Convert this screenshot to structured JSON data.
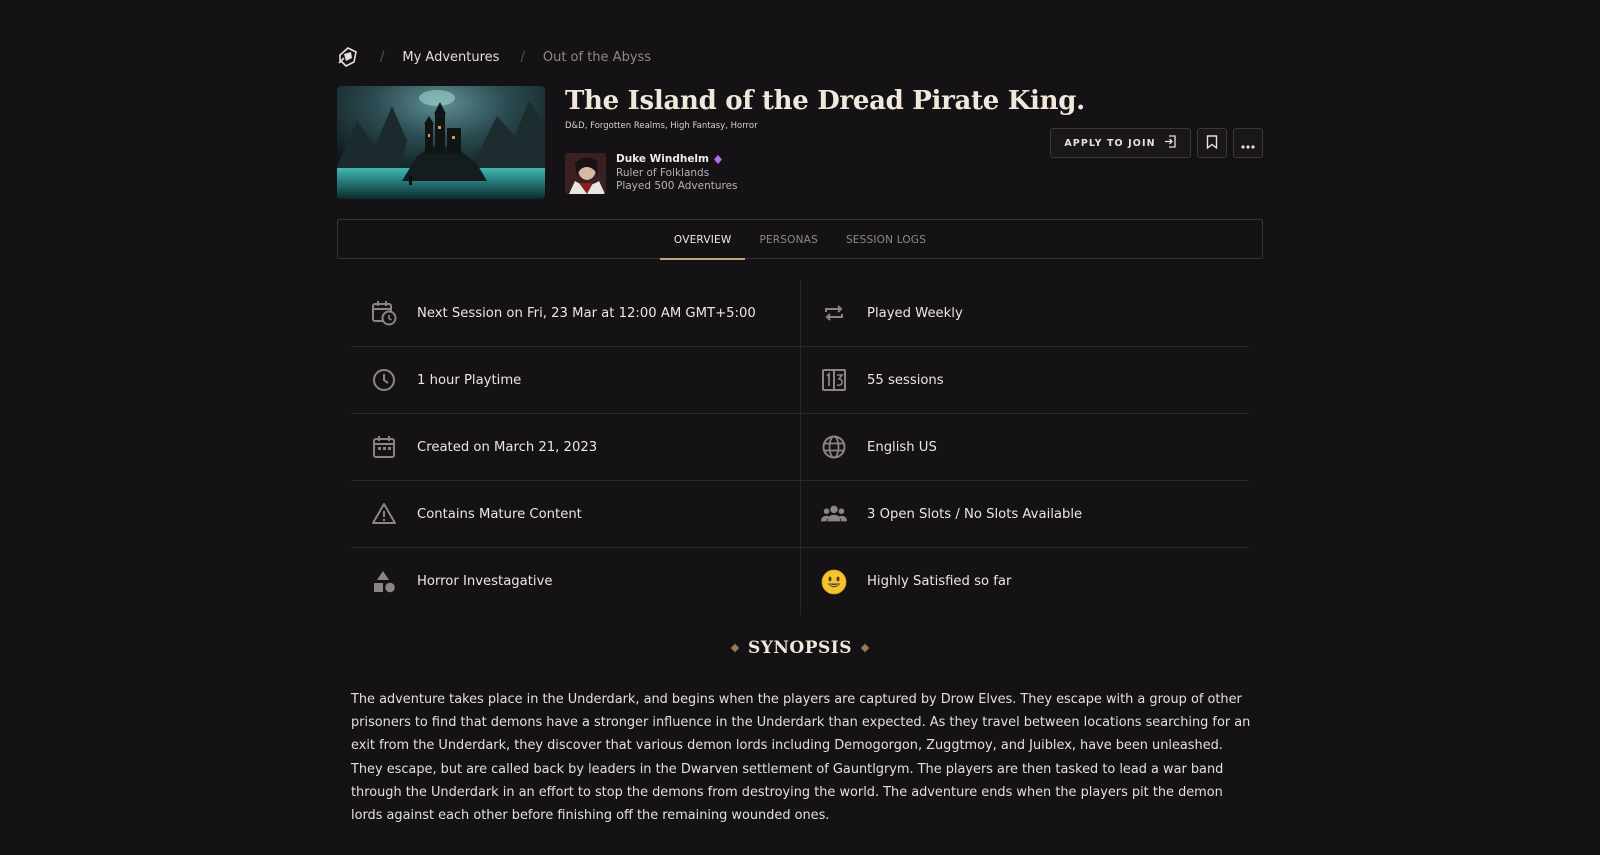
{
  "breadcrumb": {
    "logo_icon": "dice-logo-icon",
    "items": [
      "My Adventures",
      "Out of the Abyss"
    ]
  },
  "adventure": {
    "title": "The Island of the Dread Pirate King.",
    "tags": "D&D, Forgotten Realms, High Fantasy, Horror"
  },
  "gm": {
    "name": "Duke Windhelm",
    "title": "Ruler of Folklands",
    "played": "Played 500 Adventures",
    "badge_color": "#b36df0"
  },
  "actions": {
    "apply_label": "APPLY TO JOIN",
    "bookmark_icon": "bookmark-icon",
    "more_icon": "more-icon"
  },
  "tabs": [
    {
      "label": "OVERVIEW",
      "active": true
    },
    {
      "label": "PERSONAS",
      "active": false
    },
    {
      "label": "SESSION LOGS",
      "active": false
    }
  ],
  "details": {
    "next_session": "Next Session on Fri, 23 Mar at 12:00 AM GMT+5:00",
    "frequency": "Played Weekly",
    "playtime": "1 hour Playtime",
    "sessions": "55 sessions",
    "created": "Created on March 21, 2023",
    "language": "English US",
    "mature": "Contains Mature Content",
    "slots": "3 Open Slots / No Slots Available",
    "genre": "Horror Investagative",
    "satisfaction": "Highly Satisfied so far"
  },
  "synopsis": {
    "heading": "SYNOPSIS",
    "body": "The adventure takes place in the Underdark, and begins when the players are captured by Drow Elves. They escape with a group of other prisoners to find that demons have a stronger influence in the Underdark than expected. As they travel between locations searching for an exit from the Underdark, they discover that various demon lords including Demogorgon, Zuggtmoy, and Juiblex, have been unleashed. They escape, but are called back by leaders in the Dwarven settlement of Gauntlgrym. The players are then tasked to lead a war band through the Underdark in an effort to stop the demons from destroying the world. The adventure ends when the players pit the demon lords against each other before finishing off the remaining wounded ones."
  },
  "colors": {
    "background": "#141215",
    "accent": "#c8a47b",
    "icon": "#8a8489"
  }
}
